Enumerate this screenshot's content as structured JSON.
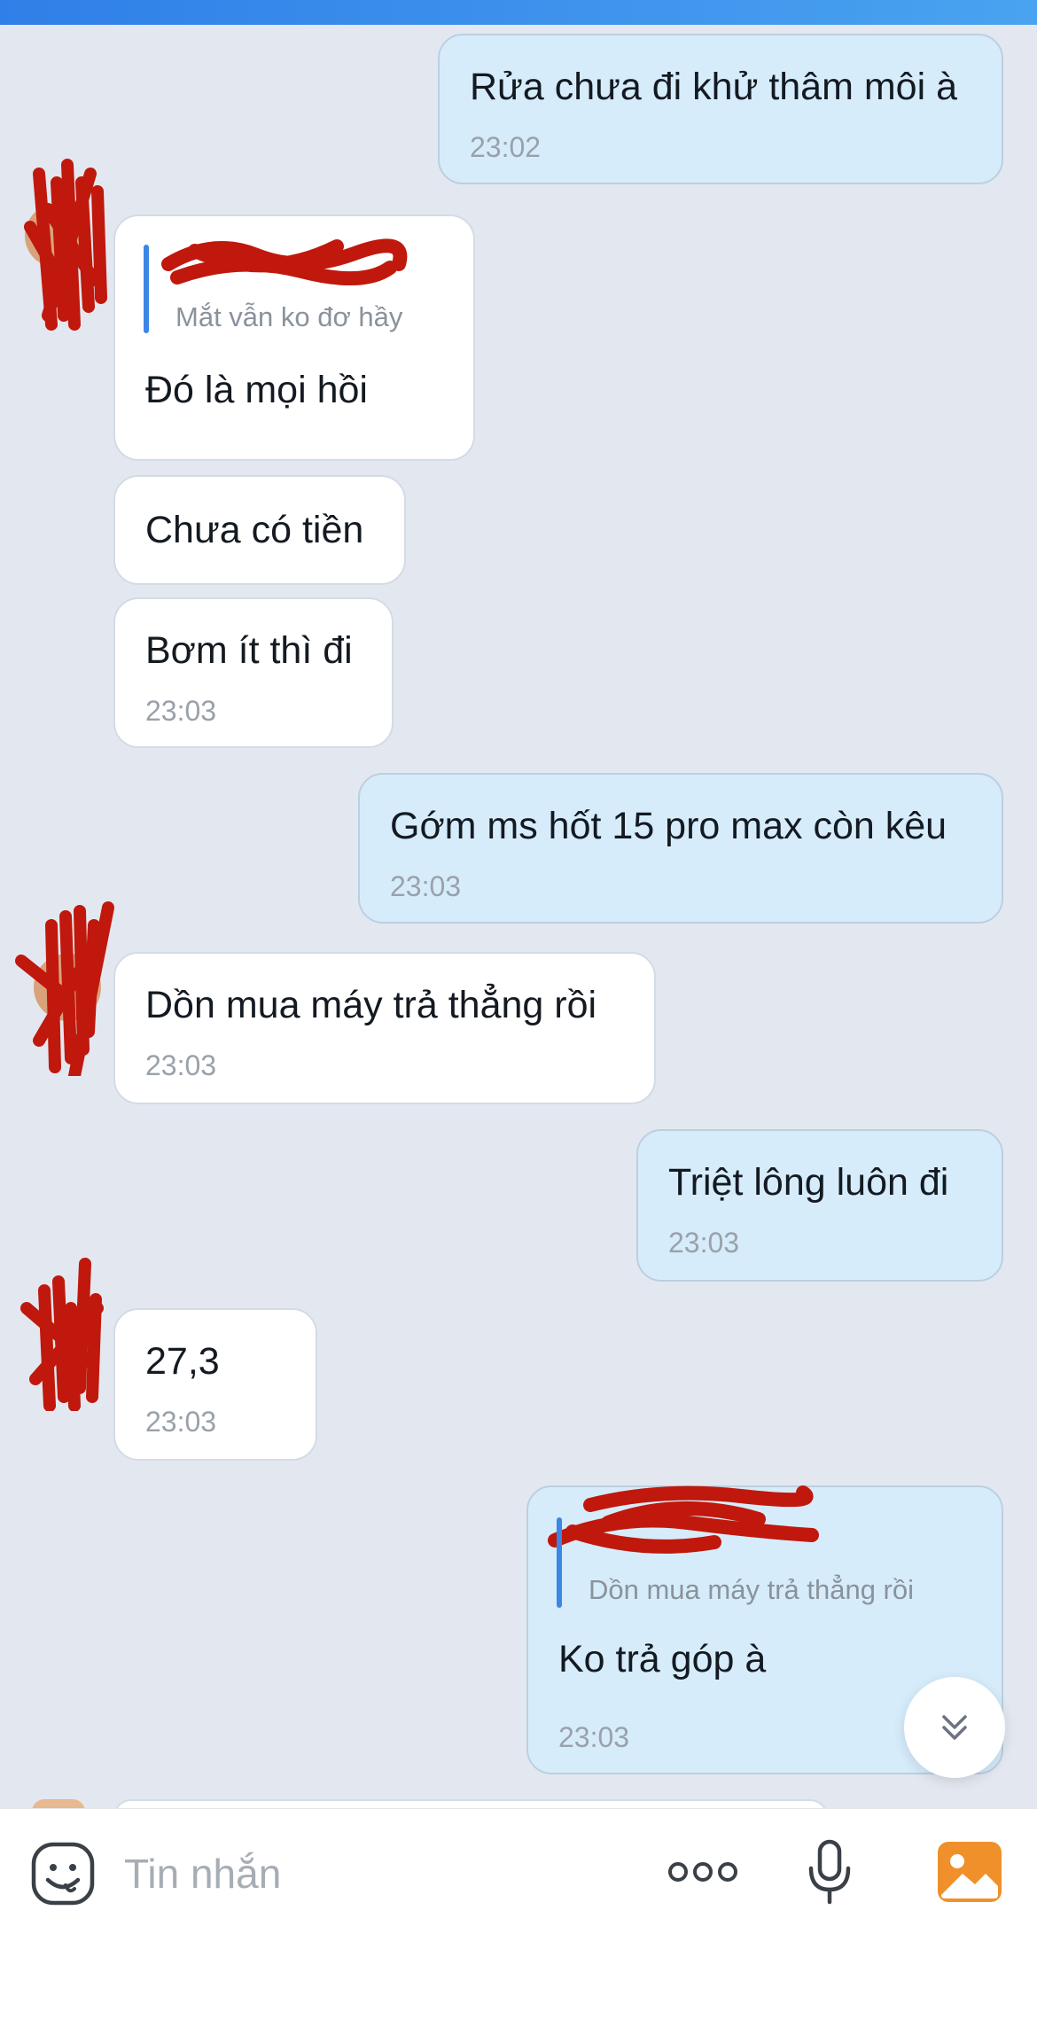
{
  "messages": [
    {
      "id": "m1",
      "side": "out",
      "text": "Rửa chưa đi khử thâm môi à",
      "time": "23:02"
    },
    {
      "id": "m2",
      "side": "in",
      "quote": "Mắt vẫn ko đơ hầy",
      "text": "Đó là mọi hồi",
      "time": ""
    },
    {
      "id": "m3",
      "side": "in",
      "text": "Chưa có tiền",
      "time": ""
    },
    {
      "id": "m4",
      "side": "in",
      "text": "Bơm ít thì đi",
      "time": "23:03"
    },
    {
      "id": "m5",
      "side": "out",
      "text": "Gớm ms hốt 15 pro max còn kêu",
      "time": "23:03"
    },
    {
      "id": "m6",
      "side": "in",
      "text": "Dồn mua máy trả thẳng rồi",
      "time": "23:03"
    },
    {
      "id": "m7",
      "side": "out",
      "text": "Triệt lông luôn đi",
      "time": "23:03"
    },
    {
      "id": "m8",
      "side": "in",
      "text": "27,3",
      "time": "23:03"
    },
    {
      "id": "m9",
      "side": "out",
      "quote": "Dồn mua máy trả thẳng rồi",
      "text": "Ko trả góp à",
      "time": "23:03"
    }
  ],
  "composer": {
    "placeholder": "Tin nhắn",
    "icons": [
      "emoji-icon",
      "more-icon",
      "microphone-icon",
      "image-icon"
    ]
  },
  "scroll_button": {
    "icon": "double-chevron-down-icon"
  },
  "colors": {
    "background": "#e3e8f0",
    "outgoing_bubble": "#d6ecfb",
    "incoming_bubble": "#ffffff",
    "quote_bar": "#3c86e6",
    "redaction": "#c0180c",
    "image_icon": "#f0902a"
  }
}
